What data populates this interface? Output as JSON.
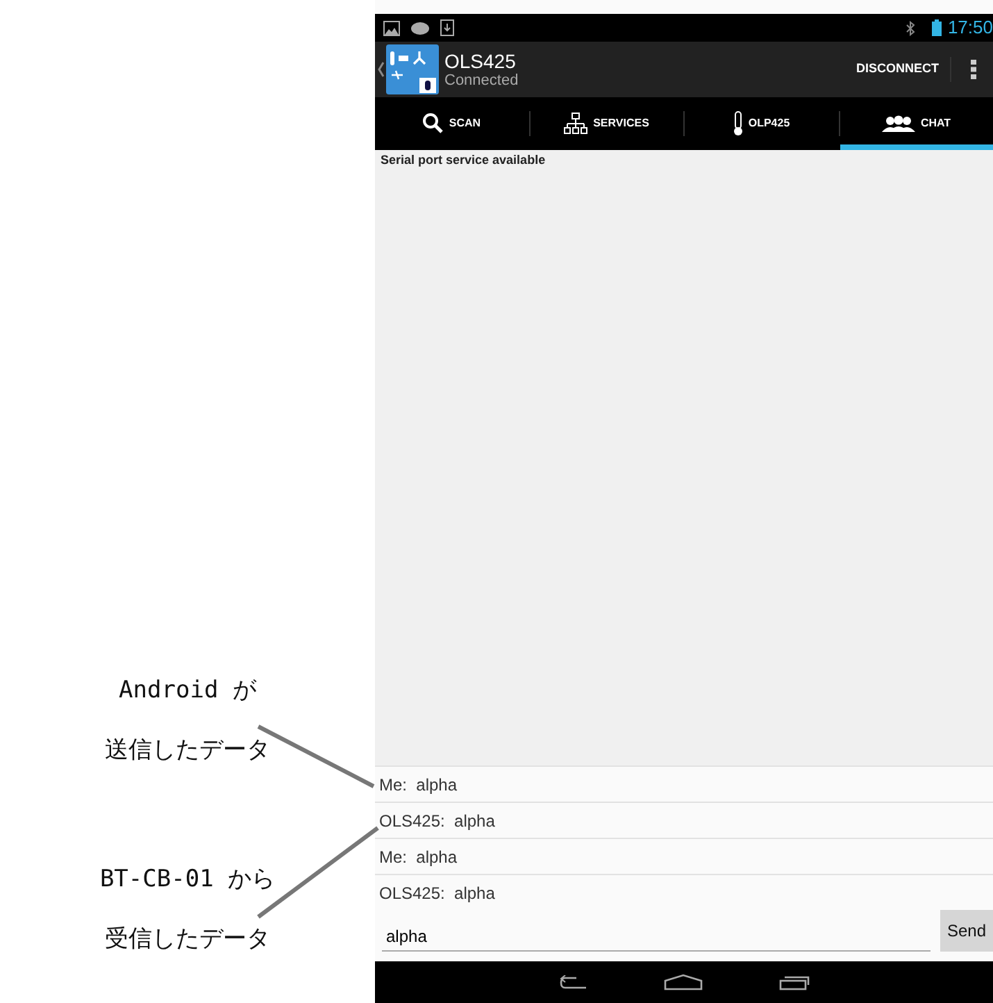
{
  "annotations": [
    {
      "lines": [
        "Android が",
        "送信したデータ"
      ]
    },
    {
      "lines": [
        "BT-CB-01 から",
        "受信したデータ"
      ]
    }
  ],
  "status_bar": {
    "time": "17:50"
  },
  "action_bar": {
    "title": "OLS425",
    "subtitle": "Connected",
    "action": "DISCONNECT"
  },
  "tabs": [
    {
      "label": "SCAN",
      "selected": false
    },
    {
      "label": "SERVICES",
      "selected": false
    },
    {
      "label": "OLP425",
      "selected": false
    },
    {
      "label": "CHAT",
      "selected": true
    }
  ],
  "status_message": "Serial port service available",
  "messages": [
    "Me:  alpha",
    "OLS425:  alpha",
    "Me:  alpha",
    "OLS425:  alpha"
  ],
  "input": {
    "value": "alpha"
  },
  "send_button": "Send"
}
